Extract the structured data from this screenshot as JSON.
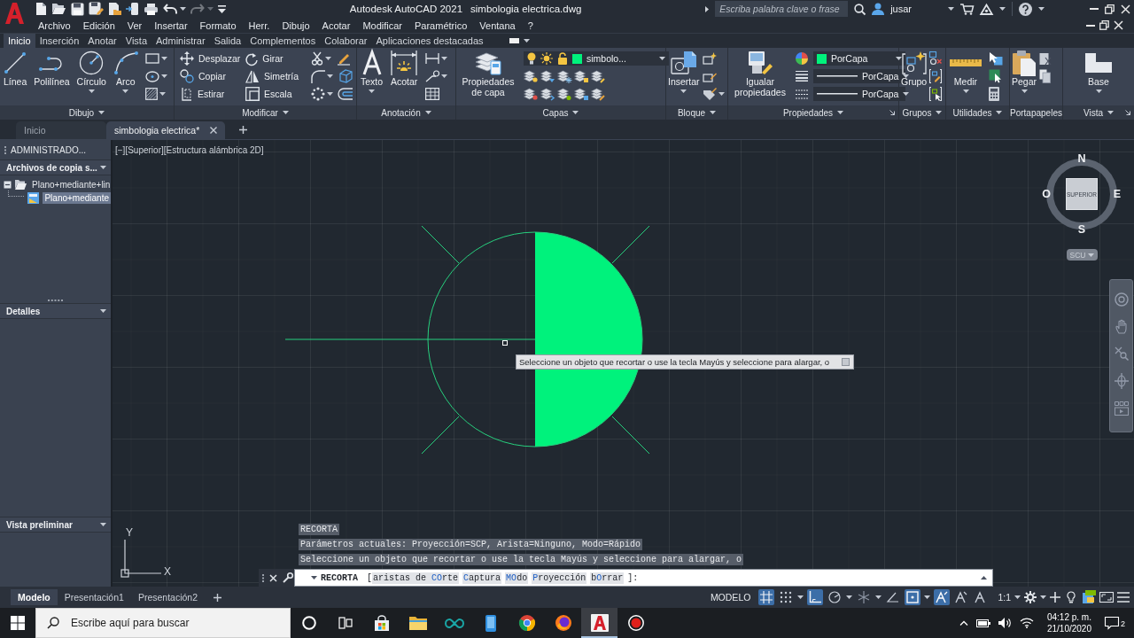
{
  "title_bar": {
    "quick_access": [
      {
        "disabled": false
      },
      {
        "disabled": false
      },
      {
        "disabled": false
      },
      {
        "disabled": false
      },
      {
        "disabled": false
      },
      {
        "disabled": false
      },
      {
        "disabled": false
      },
      {
        "disabled": false
      },
      {
        "disabled": true
      },
      {
        "disabled": false
      }
    ],
    "app": "Autodesk AutoCAD 2021",
    "document": "simbologia electrica.dwg",
    "search": {
      "placeholder": "Escriba palabra clave o frase"
    },
    "user": "jusar"
  },
  "menu_bar": [
    "Archivo",
    "Edición",
    "Ver",
    "Insertar",
    "Formato",
    "Herr.",
    "Dibujo",
    "Acotar",
    "Modificar",
    "Paramétrico",
    "Ventana",
    "?"
  ],
  "ribbon_tabs": [
    {
      "label": "Inicio",
      "selected": true
    },
    {
      "label": "Inserción",
      "selected": false
    },
    {
      "label": "Anotar",
      "selected": false
    },
    {
      "label": "Vista",
      "selected": false
    },
    {
      "label": "Administrar",
      "selected": false
    },
    {
      "label": "Salida",
      "selected": false
    },
    {
      "label": "Complementos",
      "selected": false
    },
    {
      "label": "Colaborar",
      "selected": false
    },
    {
      "label": "Aplicaciones destacadas",
      "selected": false
    }
  ],
  "ribbon_panels": [
    {
      "title": "Dibujo",
      "expandable": true,
      "launcher": false,
      "tools": [
        {
          "kind": "large",
          "label": "Línea",
          "menu": false
        },
        {
          "kind": "large",
          "label": "Polilínea",
          "menu": false
        },
        {
          "kind": "large",
          "label": "Círculo",
          "menu": true
        },
        {
          "kind": "large",
          "label": "Arco",
          "menu": true
        }
      ]
    },
    {
      "title": "Modificar",
      "expandable": true,
      "launcher": false,
      "tools": [
        {
          "kind": "small",
          "label": "Desplazar",
          "menu": false
        },
        {
          "kind": "small",
          "label": "Girar",
          "menu": false
        },
        {
          "kind": "small",
          "label": "Copiar",
          "menu": false
        },
        {
          "kind": "small",
          "label": "Simetría",
          "menu": false
        },
        {
          "kind": "small",
          "label": "Estirar",
          "menu": false
        },
        {
          "kind": "small",
          "label": "Escala",
          "menu": false
        }
      ]
    },
    {
      "title": "Anotación",
      "expandable": true,
      "launcher": false,
      "tools": [
        {
          "kind": "large",
          "label": "Texto",
          "menu": true
        },
        {
          "kind": "large",
          "label": "Acotar",
          "menu": false
        }
      ]
    },
    {
      "title": "Capas",
      "expandable": true,
      "launcher": false,
      "tools": [
        {
          "kind": "large",
          "label": "Propiedades de capa",
          "menu": false
        },
        {
          "kind": "layer",
          "label": "simbolo...",
          "color": "#00f27c",
          "menu": true
        }
      ]
    },
    {
      "title": "Bloque",
      "expandable": true,
      "launcher": false,
      "tools": [
        {
          "kind": "large",
          "label": "Insertar",
          "menu": true
        }
      ]
    },
    {
      "title": "Propiedades",
      "expandable": true,
      "launcher": true,
      "tools": [
        {
          "kind": "large",
          "label": "Igualar propiedades",
          "menu": false
        },
        {
          "kind": "dropdown",
          "label": "PorCapa",
          "color": "#00f27c",
          "menu": true
        },
        {
          "kind": "dropdown",
          "label": "PorCapa",
          "menu": true
        },
        {
          "kind": "dropdown",
          "label": "PorCapa",
          "menu": true
        }
      ]
    },
    {
      "title": "Grupos",
      "expandable": true,
      "launcher": false,
      "tools": [
        {
          "kind": "large",
          "label": "Grupo",
          "menu": false
        }
      ]
    },
    {
      "title": "Utilidades",
      "expandable": true,
      "launcher": false,
      "tools": [
        {
          "kind": "large",
          "label": "Medir",
          "menu": true
        }
      ]
    },
    {
      "title": "Portapapeles",
      "expandable": false,
      "launcher": false,
      "tools": [
        {
          "kind": "large",
          "label": "Pegar",
          "menu": true
        }
      ]
    },
    {
      "title": "Vista",
      "expandable": true,
      "launcher": true,
      "tools": [
        {
          "kind": "large",
          "label": "Base",
          "menu": true
        }
      ]
    }
  ],
  "file_tabs": [
    {
      "label": "Inicio",
      "selected": false
    },
    {
      "label": "simbologia electrica*",
      "selected": true
    }
  ],
  "palette": {
    "title": "ADMINISTRADO...",
    "sections": [
      {
        "title": "Archivos de copia s...",
        "tree": [
          {
            "label": "Plano+mediante+lin",
            "selected": false,
            "expanded": true,
            "children": [
              {
                "label": "Plano+mediante",
                "selected": true
              }
            ]
          }
        ]
      },
      {
        "title": "Detalles"
      },
      {
        "title": "Vista preliminar"
      }
    ]
  },
  "viewport": {
    "controls": [
      "[−]",
      "[Superior]",
      "[Estructura alámbrica 2D]"
    ],
    "view_cube": {
      "face": "SUPERIOR",
      "north": "N",
      "east": "E",
      "south": "S",
      "west": "O",
      "ucs_menu": "SCU"
    },
    "ucs": {
      "x": "X",
      "y": "Y"
    },
    "tooltip": "Seleccione un objeto que recortar o use la tecla Mayús y seleccione para alargar, o"
  },
  "command_window": {
    "history": [
      "RECORTA",
      "Parámetros actuales: Proyección=SCP, Arista=Ninguno, Modo=Rápido",
      "Seleccione un objeto que recortar o use la tecla Mayús y seleccione para alargar, o"
    ],
    "command": "RECORTA",
    "open": "[",
    "options": [
      {
        "before": "aristas de ",
        "key": "CO",
        "after": "rte"
      },
      {
        "key": "C",
        "after": "aptura"
      },
      {
        "key": "MO",
        "after": "do"
      },
      {
        "key": "P",
        "after": "royección"
      },
      {
        "before": "b",
        "key": "O",
        "after": "rrar"
      }
    ],
    "close": "]:"
  },
  "layout_tabs": [
    {
      "label": "Modelo",
      "selected": true
    },
    {
      "label": "Presentación1",
      "selected": false
    },
    {
      "label": "Presentación2",
      "selected": false
    }
  ],
  "status_bar": {
    "space": "MODELO",
    "toggles": [
      {
        "on": true,
        "menu": false
      },
      {
        "on": false,
        "menu": true
      },
      {
        "on": true,
        "menu": false
      },
      {
        "on": false,
        "menu": true
      },
      {
        "on": false,
        "menu": true
      },
      {
        "on": false,
        "menu": false
      },
      {
        "on": true,
        "menu": true
      },
      {
        "on": true,
        "menu": false
      },
      {
        "on": false,
        "menu": false
      },
      {
        "on": false,
        "menu": false
      }
    ],
    "scale": "1:1"
  },
  "taskbar": {
    "search": {
      "placeholder": "Escribe aquí para buscar"
    },
    "apps": [
      {
        "selected": false
      },
      {
        "selected": false
      },
      {
        "selected": false
      },
      {
        "selected": false
      },
      {
        "selected": false
      },
      {
        "selected": false
      },
      {
        "selected": true
      },
      {
        "selected": false
      }
    ],
    "time": "04:12 p. m.",
    "date": "21/10/2020",
    "notifications": "2"
  }
}
